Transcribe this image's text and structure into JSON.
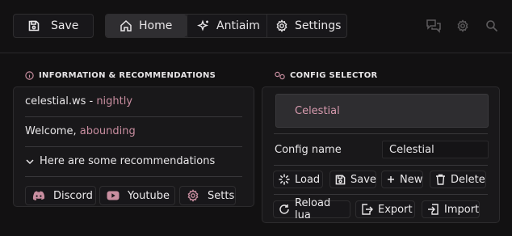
{
  "toolbar": {
    "save_label": "Save"
  },
  "tabs": [
    {
      "label": "Home",
      "icon": "home-icon",
      "active": true
    },
    {
      "label": "Antiaim",
      "icon": "sparkle-icon",
      "active": false
    },
    {
      "label": "Settings",
      "icon": "gear-icon",
      "active": false
    }
  ],
  "top_icons": [
    "chat-icon",
    "gear-icon",
    "search-icon"
  ],
  "info": {
    "title": "INFORMATION & RECOMMENDATIONS",
    "brand": "celestial.ws - ",
    "build": "nightly",
    "welcome_prefix": "Welcome, ",
    "username": "abounding",
    "recommendations": "Here are some recommendations",
    "links": [
      {
        "label": "Discord",
        "icon": "discord-icon"
      },
      {
        "label": "Youtube",
        "icon": "youtube-icon"
      },
      {
        "label": "Setts",
        "icon": "gear-icon"
      }
    ]
  },
  "config": {
    "title": "CONFIG SELECTOR",
    "list": [
      "Celestial"
    ],
    "name_label": "Config name",
    "name_value": "Celestial",
    "buttons": {
      "load": "Load",
      "save": "Save",
      "new": "New",
      "delete": "Delete",
      "reload": "Reload lua",
      "export": "Export",
      "import": "Import"
    }
  },
  "colors": {
    "accent": "#c98ea0",
    "background": "#121112",
    "panel": "#19181a"
  }
}
